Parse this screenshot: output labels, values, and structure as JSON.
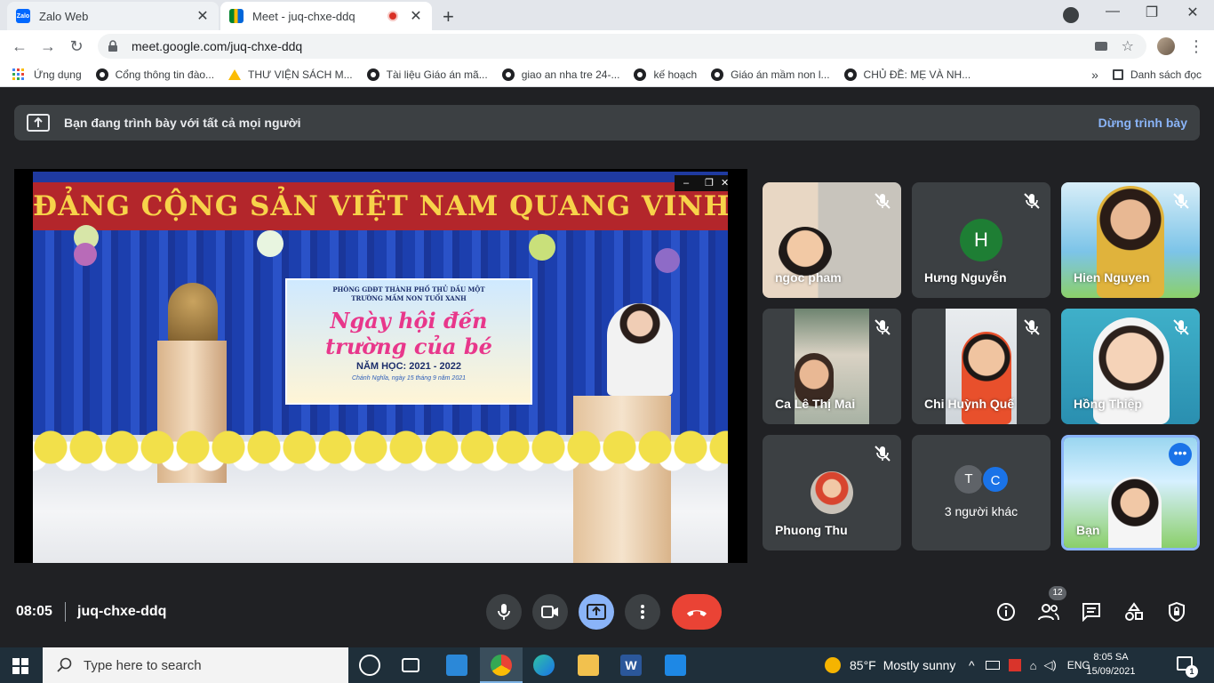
{
  "browser": {
    "tabs": [
      {
        "title": "Zalo Web",
        "favicon_text": "Zalo",
        "active": false
      },
      {
        "title": "Meet - juq-chxe-ddq",
        "active": true,
        "recording": true
      }
    ],
    "url": "meet.google.com/juq-chxe-ddq",
    "bookmarks": [
      {
        "label": "Ứng dụng",
        "icon": "apps-grid-icon"
      },
      {
        "label": "Cổng thông tin đào...",
        "icon": "globe-icon"
      },
      {
        "label": "THƯ VIỆN SÁCH M...",
        "icon": "drive-icon"
      },
      {
        "label": "Tài liệu Giáo án mã...",
        "icon": "globe-icon"
      },
      {
        "label": "giao an nha tre 24-...",
        "icon": "globe-icon"
      },
      {
        "label": "kế hoạch",
        "icon": "globe-icon"
      },
      {
        "label": "Giáo án mầm non l...",
        "icon": "globe-icon"
      },
      {
        "label": "CHỦ ĐỀ: MẸ VÀ NH...",
        "icon": "globe-icon"
      }
    ],
    "reading_list": "Danh sách đọc",
    "more_bookmarks": "»"
  },
  "meet": {
    "presenting_message": "Bạn đang trình bày với tất cả mọi người",
    "stop_presenting": "Dừng trình bày",
    "presentation": {
      "banner": "ĐẢNG CỘNG SẢN VIỆT NAM QUANG VINH MUÔN NĂM",
      "poster_org_line1": "PHÒNG GDĐT THÀNH PHỐ THỦ DẦU MỘT",
      "poster_org_line2": "TRƯỜNG MẦM NON TUỔI XANH",
      "poster_title": "Ngày hội đến trường của bé",
      "poster_year": "NĂM HỌC: 2021 - 2022",
      "poster_date": "Chánh Nghĩa, ngày 15 tháng 9 năm 2021"
    },
    "participants": [
      {
        "name": "ngoc pham",
        "muted": true,
        "type": "video"
      },
      {
        "name": "Hưng Nguyễn",
        "muted": true,
        "type": "initial",
        "initial": "H"
      },
      {
        "name": "Hien Nguyen",
        "muted": true,
        "type": "video"
      },
      {
        "name": "Ca Lê Thị Mai",
        "muted": true,
        "type": "video"
      },
      {
        "name": "Chi Huỳnh Quế",
        "muted": true,
        "type": "video"
      },
      {
        "name": "Hồng Thiệp",
        "muted": true,
        "type": "video"
      },
      {
        "name": "Phuong Thu",
        "muted": true,
        "type": "avatar"
      },
      {
        "name": "3 người khác",
        "type": "others",
        "initials": [
          "T",
          "C"
        ]
      },
      {
        "name": "Bạn",
        "type": "self",
        "active": true
      }
    ],
    "time": "08:05",
    "meeting_code": "juq-chxe-ddq",
    "people_count": "12"
  },
  "taskbar": {
    "search_placeholder": "Type here to search",
    "weather_temp": "85°F",
    "weather_text": "Mostly sunny",
    "language": "ENG",
    "time": "8:05 SA",
    "date": "15/09/2021",
    "notification_count": "1"
  },
  "colors": {
    "meet_bg": "#202124",
    "tile_bg": "#3c4043",
    "accent_blue": "#8ab4f8",
    "end_call_red": "#ea4335",
    "initial_green": "#1e7e34"
  }
}
